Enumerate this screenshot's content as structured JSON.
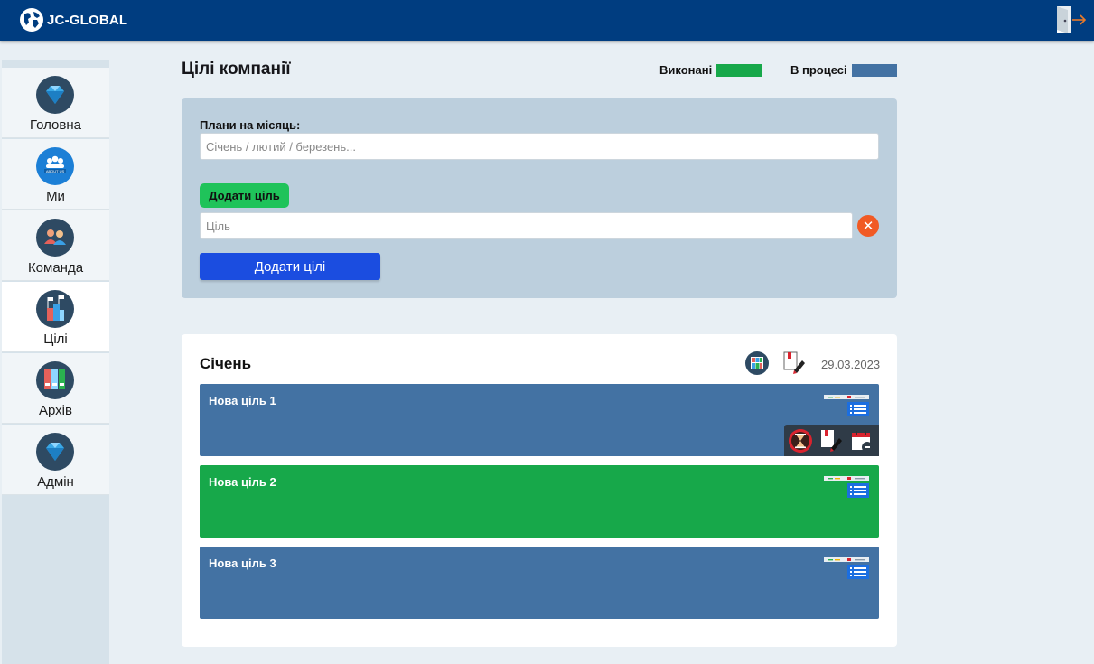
{
  "header": {
    "brand": "JC-GLOBAL",
    "logo_icon": "globe-icon",
    "logout_icon": "exit-door-icon",
    "background": "#003d80"
  },
  "sidebar": {
    "items": [
      {
        "label": "Головна",
        "icon": "diamond-icon",
        "active": false
      },
      {
        "label": "Ми",
        "icon": "about-us-icon",
        "active": false
      },
      {
        "label": "Команда",
        "icon": "team-icon",
        "active": false
      },
      {
        "label": "Цілі",
        "icon": "goals-icon",
        "active": true
      },
      {
        "label": "Архів",
        "icon": "archive-icon",
        "active": false
      },
      {
        "label": "Адмін",
        "icon": "diamond-icon",
        "active": false
      }
    ]
  },
  "page": {
    "title": "Цілі компанії",
    "legend": {
      "done_label": "Виконані",
      "done_color": "#17a84a",
      "in_progress_label": "В процесі",
      "in_progress_color": "#4372a3"
    }
  },
  "form": {
    "plans_label": "Плани на місяць:",
    "plans_placeholder": "Січень / лютий / березень...",
    "add_goal_button": "Додати ціль",
    "goal_placeholder": "Ціль",
    "remove_icon": "close-circle-icon",
    "submit_button": "Додати цілі"
  },
  "month": {
    "title": "Січень",
    "date": "29.03.2023",
    "icons": [
      "board-icon",
      "edit-note-icon"
    ],
    "goals": [
      {
        "title": "Нова ціль 1",
        "status": "in_progress",
        "color": "#4372a3",
        "actions": [
          "hourglass-icon",
          "edit-note-icon",
          "calendar-remove-icon"
        ]
      },
      {
        "title": "Нова ціль 2",
        "status": "done",
        "color": "#17a84a"
      },
      {
        "title": "Нова ціль 3",
        "status": "in_progress",
        "color": "#4372a3"
      }
    ]
  }
}
